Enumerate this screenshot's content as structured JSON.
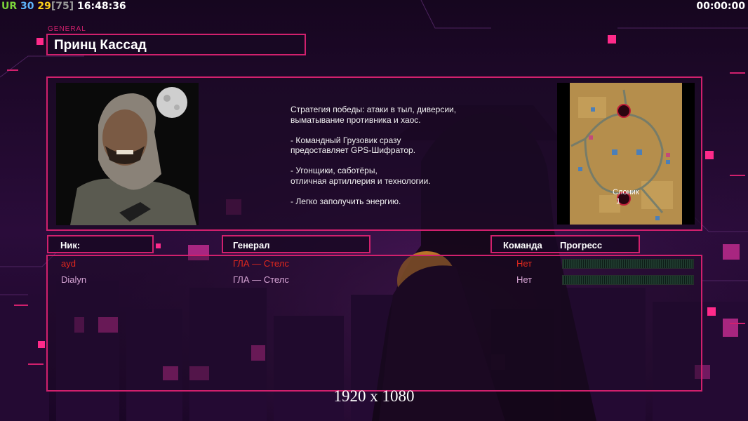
{
  "hud": {
    "ur_label": "UR",
    "ur_value": "30",
    "fps": "29",
    "fps_cap": "[75]",
    "clock": "16:48:36",
    "timer": "00:00:00"
  },
  "general": {
    "tag": "GENERAL",
    "name": "Принц Кассад",
    "description": [
      "Стратегия победы: атаки в тыл, диверсии,\n выматывание противника и хаос.",
      "- Командный Грузовик сразу\nпредоставляет GPS-Шифратор.",
      "- Угонщики, саботёры,\nотличная артиллерия и технологии.",
      "- Легко заполучить энергию."
    ]
  },
  "map": {
    "label": "Слоник",
    "player_number": "1"
  },
  "table": {
    "headers": {
      "nick": "Ник:",
      "general": "Генерал",
      "team": "Команда",
      "progress": "Прогресс"
    },
    "rows": [
      {
        "nick": "ayd",
        "general": "ГЛА — Стелс",
        "team": "Нет",
        "progress": 0,
        "color": "#e0281e"
      },
      {
        "nick": "Dialyn",
        "general": "ГЛА — Стелс",
        "team": "Нет",
        "progress": 0,
        "color": "#d8a6d6"
      }
    ]
  },
  "resolution": "1920 x 1080",
  "colors": {
    "accent": "#d1206d",
    "background": "#1a0826",
    "player1": "#e0281e",
    "player2": "#d8a6d6"
  }
}
